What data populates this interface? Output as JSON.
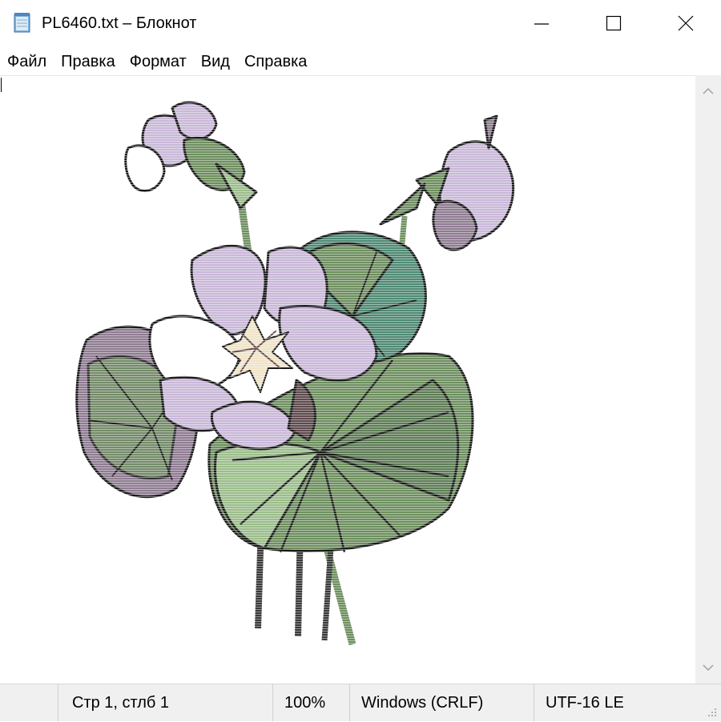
{
  "window": {
    "title": "PL6460.txt – Блокнот",
    "icon": "notepad-icon"
  },
  "controls": {
    "minimize_icon": "minimize-icon",
    "maximize_icon": "maximize-icon",
    "close_icon": "close-icon"
  },
  "menu": {
    "items": [
      {
        "label": "Файл"
      },
      {
        "label": "Правка"
      },
      {
        "label": "Формат"
      },
      {
        "label": "Вид"
      },
      {
        "label": "Справка"
      }
    ]
  },
  "status": {
    "position": "Стр 1, стлб 1",
    "zoom": "100%",
    "line_endings": "Windows (CRLF)",
    "encoding": "UTF-16 LE"
  },
  "colors": {
    "accent_leaf": "#6e8f5f",
    "leaf_light": "#9bbd8b",
    "leaf_teal": "#4f8a74",
    "petal_lilac": "#c9b8d8",
    "petal_mauve": "#8f7c92",
    "shade_brown": "#5e4a4f",
    "outline": "#1a1a1a"
  }
}
